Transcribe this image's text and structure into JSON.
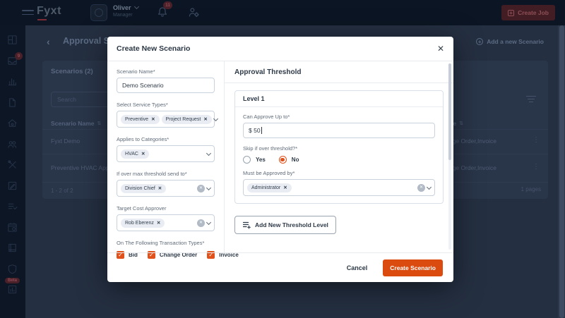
{
  "topbar": {
    "logo": "Fyxt",
    "user": {
      "name": "Oliver",
      "role": "Manager"
    },
    "notifications_badge": "11",
    "create_job_label": "Create Job"
  },
  "sidebar": {
    "items": [
      "dashboard",
      "jobs-inbox",
      "analytics",
      "documents",
      "properties",
      "team",
      "equipment",
      "notes",
      "tasks",
      "schedule",
      "ledger",
      "compliance",
      "reports"
    ],
    "inbox_badge": "9",
    "beta_badge": "Beta"
  },
  "page": {
    "title": "Approval Scenarios",
    "add_scenario_link": "Add a new Scenario",
    "panel_title": "Scenarios (2)",
    "search_placeholder": "Search",
    "table": {
      "name_header": "Scenario Name",
      "type_header": "Transaction Type",
      "rows": [
        {
          "name": "Fyxt Demo",
          "type": "Bid,Change Order,Invoice"
        },
        {
          "name": "Preventive HVAC Approvals",
          "type": "Bid,Change Order,Invoice"
        }
      ],
      "range": "1 - 2 of 2",
      "pages": "1 pages"
    }
  },
  "modal": {
    "title": "Create New Scenario",
    "fields": {
      "scenario_name": {
        "label": "Scenario Name*",
        "value": "Demo Scenario"
      },
      "service_types": {
        "label": "Select Service Types*",
        "chips": [
          "Preventive",
          "Project Request"
        ]
      },
      "categories": {
        "label": "Applies to Categories*",
        "chips": [
          "HVAC"
        ]
      },
      "over_max_send_to": {
        "label": "If over max threshold send to*",
        "chips": [
          "Division Chief"
        ]
      },
      "target_cost_approver": {
        "label": "Target Cost Approver",
        "chips": [
          "Rob Eberenz"
        ]
      },
      "transaction_types": {
        "label": "On The Following Transaction Types*",
        "options": [
          "Bid",
          "Change Order",
          "Invoice"
        ],
        "all_checked": true
      }
    },
    "threshold": {
      "heading": "Approval Threshold",
      "level": {
        "title": "Level 1",
        "approve_up_to": {
          "label": "Can Approve Up to*",
          "value": "$ 50"
        },
        "skip": {
          "label": "Skip if over threshold?*",
          "yes": "Yes",
          "no": "No",
          "selected": "No"
        },
        "approved_by": {
          "label": "Must be Approved by*",
          "chips": [
            "Administrator"
          ]
        }
      },
      "add_level_label": "Add New Threshold Level"
    },
    "footer": {
      "cancel": "Cancel",
      "submit": "Create Scenario"
    }
  },
  "icons": {
    "close": "✕",
    "remove": "✕",
    "kebab": "⋮",
    "sort": "⇅",
    "check": "✓",
    "back": "‹",
    "plus": "+"
  },
  "colors": {
    "accent": "#DB4B10",
    "checkbox": "#E1511B",
    "chip_bg": "#E9EDF3",
    "topbar_bg": "#0C1523"
  }
}
